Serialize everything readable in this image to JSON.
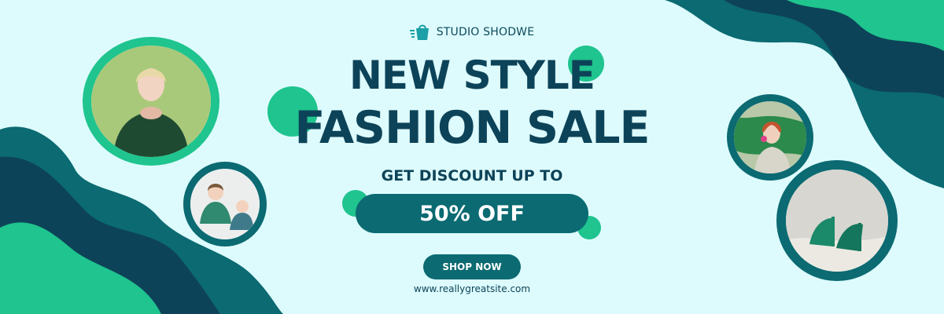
{
  "brand": {
    "name": "STUDIO SHODWE",
    "icon": "shopping-bag-icon"
  },
  "headline": {
    "line1": "NEW STYLE",
    "line2": "FASHION SALE"
  },
  "offer": {
    "subtitle": "GET DISCOUNT UP TO",
    "amount": "50% OFF"
  },
  "cta": {
    "label": "SHOP NOW"
  },
  "website": "www.reallygreatsite.com",
  "colors": {
    "background": "#ddfbfd",
    "dark_teal": "#0b6a72",
    "navy": "#0d4358",
    "green": "#1fc48e"
  }
}
